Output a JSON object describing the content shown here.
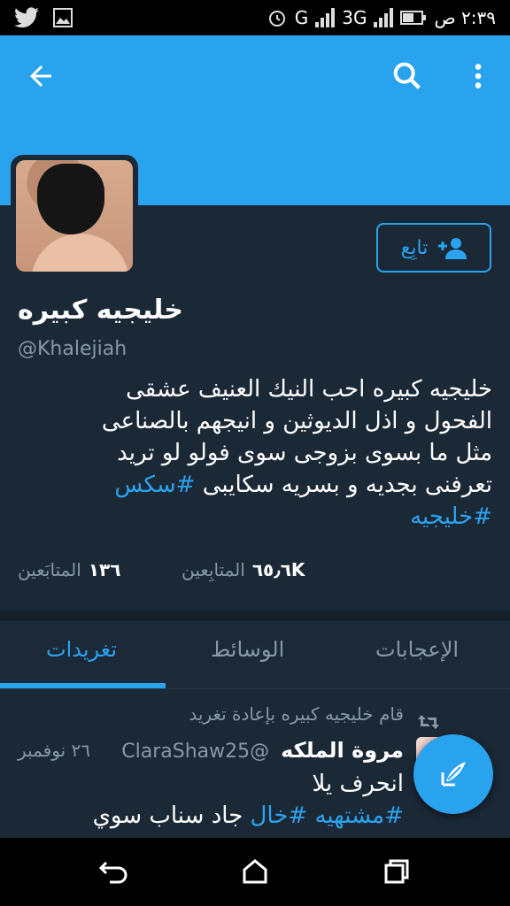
{
  "status_bar": {
    "network_label": "G",
    "network_3g": "3G",
    "time": "٢:٣٩ ص"
  },
  "app_bar": {
    "back_icon": "arrow-left-icon",
    "search_icon": "search-icon",
    "more_icon": "more-vert-icon"
  },
  "profile": {
    "follow_label": "تابِع",
    "name": "خليجيه كبيره",
    "handle": "@Khalejiah",
    "bio_lines": [
      "خليجيه كبيره احب النيك العنيف عشقى",
      "الفحول و اذل الديوثين و انيجهم بالصناعى",
      "مثل ما بسوى بزوجى  سوى فولو لو تريد",
      "تعرفنى بجديه و بسريه سكايبى"
    ],
    "hashtag_1": "#سكس",
    "hashtag_2": "#خليجيه",
    "following_count": "١٣٦",
    "following_label": "المتابَعين",
    "followers_count": "٦٥٫٦K",
    "followers_label": "المتابِعين"
  },
  "tabs": {
    "tweets": "تغريدات",
    "media": "الوسائط",
    "likes": "الإعجابات"
  },
  "tweet": {
    "retweet_note": "قام خليجيه كبيره بإعادة تغريد",
    "author_name": "مروة الملكه",
    "author_handle": "@ClaraShaw25",
    "date": "٢٦ نوفمبر",
    "line_1": "انحرف يلا",
    "tag_1": "#مشتهيه",
    "tag_2": "#خال",
    "line_2_rest": "جاد سناب سوي"
  },
  "colors": {
    "accent": "#2aa3ef",
    "background": "#1b2836",
    "secondary_text": "#8899a6"
  }
}
